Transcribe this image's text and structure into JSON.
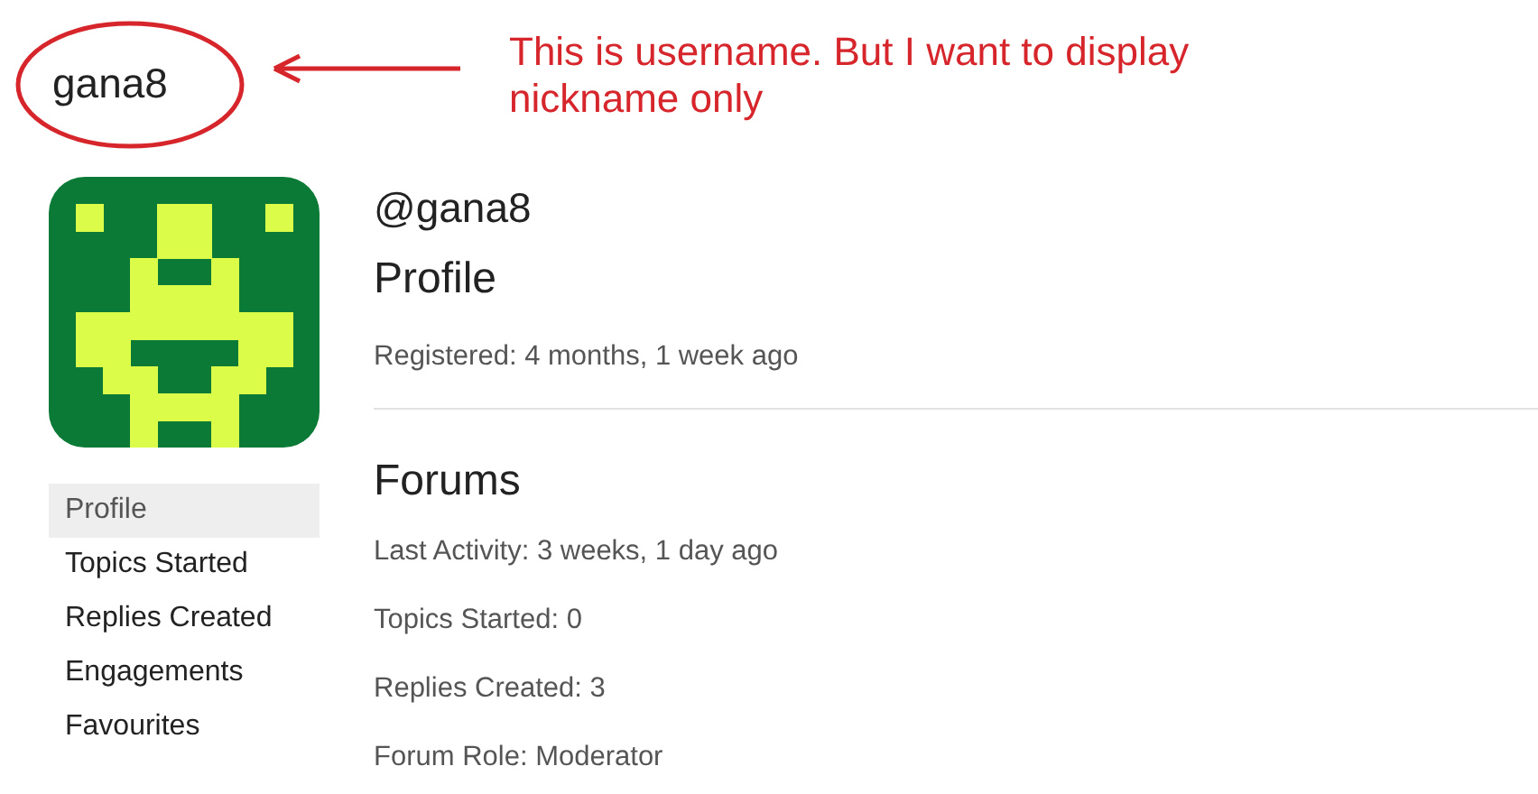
{
  "page_title": "gana8",
  "annotation": {
    "text": "This is username. But I want to display nickname only"
  },
  "profile": {
    "handle": "@gana8",
    "heading": "Profile",
    "registered": "Registered: 4 months, 1 week ago"
  },
  "sidebar": {
    "items": [
      {
        "label": "Profile",
        "selected": true
      },
      {
        "label": "Topics Started",
        "selected": false
      },
      {
        "label": "Replies Created",
        "selected": false
      },
      {
        "label": "Engagements",
        "selected": false
      },
      {
        "label": "Favourites",
        "selected": false
      }
    ]
  },
  "forums": {
    "heading": "Forums",
    "stats": [
      "Last Activity: 3 weeks, 1 day ago",
      "Topics Started: 0",
      "Replies Created: 3",
      "Forum Role: Moderator"
    ]
  }
}
